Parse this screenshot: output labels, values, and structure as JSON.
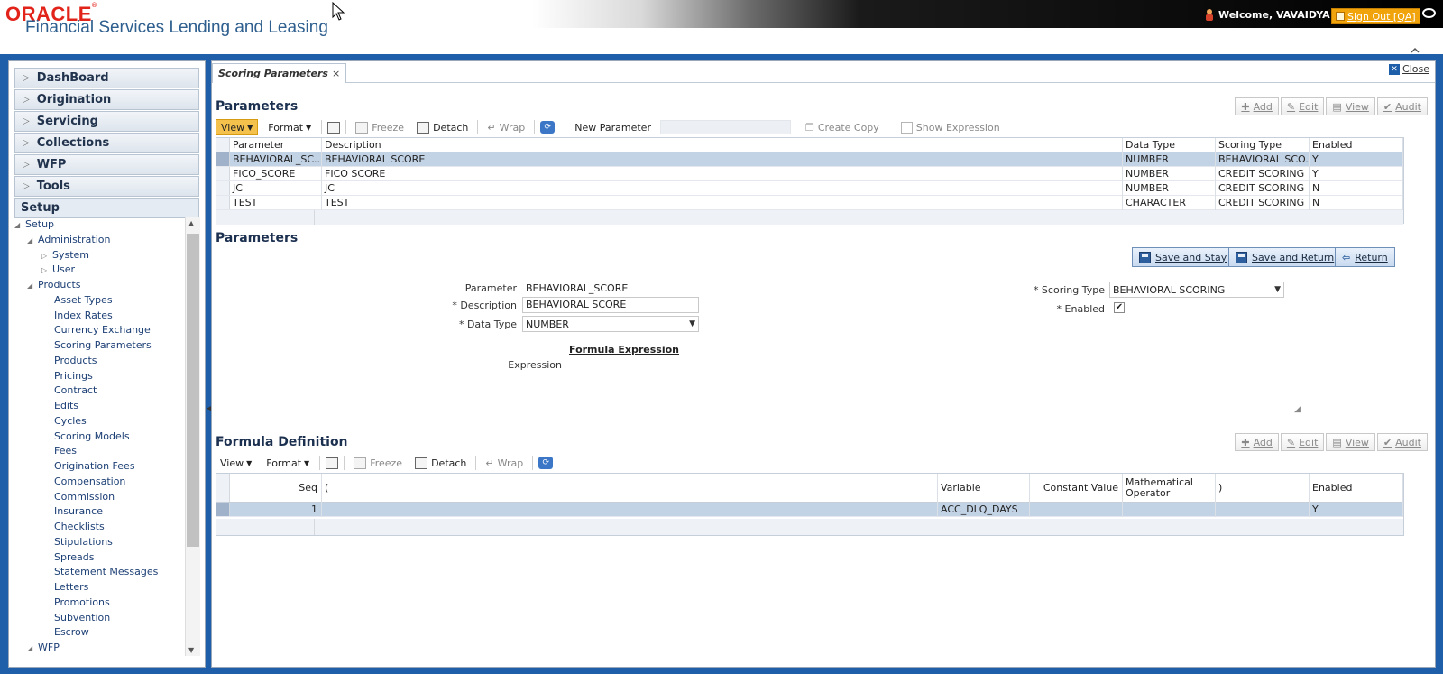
{
  "header": {
    "brand": "ORACLE",
    "brand_mark": "®",
    "app_name": "Financial Services Lending and Leasing",
    "welcome": "Welcome, VAVAIDYA",
    "sign_out": "Sign Out [QA]"
  },
  "nav": {
    "accordion": [
      "DashBoard",
      "Origination",
      "Servicing",
      "Collections",
      "WFP",
      "Tools"
    ],
    "setup_label": "Setup",
    "tree": [
      {
        "label": "Setup",
        "level": 0,
        "toggle": "◢"
      },
      {
        "label": "Administration",
        "level": 1,
        "toggle": "◢"
      },
      {
        "label": "System",
        "level": 2,
        "toggle": "▷"
      },
      {
        "label": "User",
        "level": 2,
        "toggle": "▷"
      },
      {
        "label": "Products",
        "level": 1,
        "toggle": "◢"
      },
      {
        "label": "Asset Types",
        "level": 3,
        "toggle": ""
      },
      {
        "label": "Index Rates",
        "level": 3,
        "toggle": ""
      },
      {
        "label": "Currency Exchange",
        "level": 3,
        "toggle": ""
      },
      {
        "label": "Scoring Parameters",
        "level": 3,
        "toggle": ""
      },
      {
        "label": "Products",
        "level": 3,
        "toggle": ""
      },
      {
        "label": "Pricings",
        "level": 3,
        "toggle": ""
      },
      {
        "label": "Contract",
        "level": 3,
        "toggle": ""
      },
      {
        "label": "Edits",
        "level": 3,
        "toggle": ""
      },
      {
        "label": "Cycles",
        "level": 3,
        "toggle": ""
      },
      {
        "label": "Scoring Models",
        "level": 3,
        "toggle": ""
      },
      {
        "label": "Fees",
        "level": 3,
        "toggle": ""
      },
      {
        "label": "Origination Fees",
        "level": 3,
        "toggle": ""
      },
      {
        "label": "Compensation",
        "level": 3,
        "toggle": ""
      },
      {
        "label": "Commission",
        "level": 3,
        "toggle": ""
      },
      {
        "label": "Insurance",
        "level": 3,
        "toggle": ""
      },
      {
        "label": "Checklists",
        "level": 3,
        "toggle": ""
      },
      {
        "label": "Stipulations",
        "level": 3,
        "toggle": ""
      },
      {
        "label": "Spreads",
        "level": 3,
        "toggle": ""
      },
      {
        "label": "Statement Messages",
        "level": 3,
        "toggle": ""
      },
      {
        "label": "Letters",
        "level": 3,
        "toggle": ""
      },
      {
        "label": "Promotions",
        "level": 3,
        "toggle": ""
      },
      {
        "label": "Subvention",
        "level": 3,
        "toggle": ""
      },
      {
        "label": "Escrow",
        "level": 3,
        "toggle": ""
      },
      {
        "label": "WFP",
        "level": 1,
        "toggle": "◢"
      }
    ]
  },
  "tab": {
    "label": "Scoring Parameters",
    "close": "×"
  },
  "close_label": "Close",
  "grid_buttons": {
    "add": "Add",
    "edit": "Edit",
    "view": "View",
    "audit": "Audit"
  },
  "toolbar": {
    "view": "View",
    "format": "Format",
    "freeze": "Freeze",
    "detach": "Detach",
    "wrap": "Wrap",
    "new_parameter": "New Parameter",
    "create_copy": "Create Copy",
    "show_expression": "Show Expression"
  },
  "parameters_table": {
    "title": "Parameters",
    "columns": [
      "Parameter",
      "Description",
      "Data Type",
      "Scoring Type",
      "Enabled"
    ],
    "rows": [
      [
        "BEHAVIORAL_SC...",
        "BEHAVIORAL SCORE",
        "NUMBER",
        "BEHAVIORAL SCO...",
        "Y"
      ],
      [
        "FICO_SCORE",
        "FICO SCORE",
        "NUMBER",
        "CREDIT SCORING",
        "Y"
      ],
      [
        "JC",
        "JC",
        "NUMBER",
        "CREDIT SCORING",
        "N"
      ],
      [
        "TEST",
        "TEST",
        "CHARACTER",
        "CREDIT SCORING",
        "N"
      ]
    ]
  },
  "form": {
    "title": "Parameters",
    "save_and_stay": "Save and Stay",
    "save_and_return": "Save and Return",
    "return": "Return",
    "parameter_label": "Parameter",
    "parameter_value": "BEHAVIORAL_SCORE",
    "description_label": "* Description",
    "description_value": "BEHAVIORAL SCORE",
    "data_type_label": "* Data Type",
    "data_type_value": "NUMBER",
    "scoring_type_label": "* Scoring Type",
    "scoring_type_value": "BEHAVIORAL SCORING",
    "enabled_label": "* Enabled",
    "enabled_checked": true,
    "formula_expression_title": "Formula Expression",
    "expression_label": "Expression",
    "expression_value": ""
  },
  "formula_table": {
    "title": "Formula Definition",
    "columns": [
      "Seq",
      "(",
      "Variable",
      "Constant Value",
      "Mathematical Operator",
      ")",
      "Enabled"
    ],
    "rows": [
      [
        "1",
        "",
        "ACC_DLQ_DAYS",
        "",
        "",
        "",
        "Y"
      ]
    ]
  }
}
